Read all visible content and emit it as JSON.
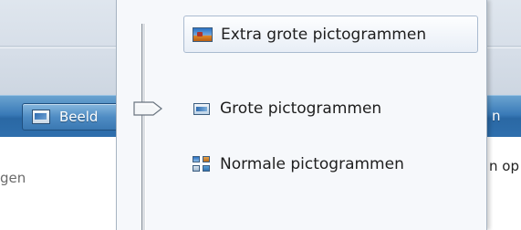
{
  "background_window": {
    "toolbar_button_label": "Beeld",
    "toolbar_right_fragment": "n",
    "content_left_fragment": "gen",
    "content_right_fragment": "n op"
  },
  "view_menu": {
    "items": [
      {
        "label": "Extra grote pictogrammen",
        "icon": "extra-large-icons-icon",
        "selected": true
      },
      {
        "label": "Grote pictogrammen",
        "icon": "large-icons-icon",
        "selected": false
      },
      {
        "label": "Normale pictogrammen",
        "icon": "medium-icons-icon",
        "selected": false
      }
    ],
    "slider_icon": "slider-thumb-icon"
  }
}
